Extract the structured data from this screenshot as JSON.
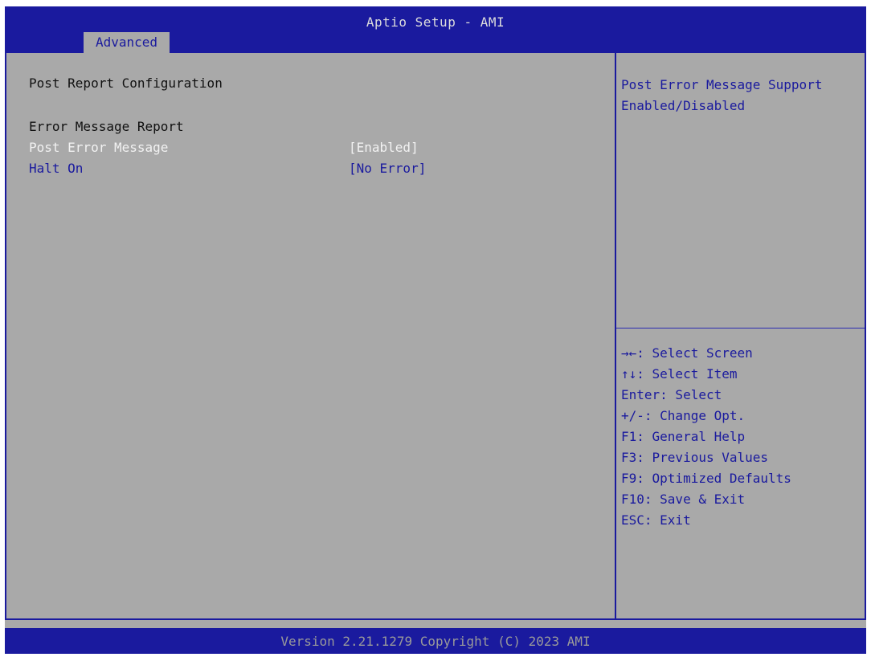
{
  "header": {
    "title": "Aptio Setup - AMI",
    "active_tab": "Advanced"
  },
  "main": {
    "section_title": "Post Report Configuration",
    "group_title": "Error Message Report",
    "settings": [
      {
        "label": "Post Error Message",
        "value": "[Enabled]"
      },
      {
        "label": "Halt On",
        "value": "[No Error]"
      }
    ]
  },
  "help": {
    "lines": [
      "Post Error Message Support",
      "Enabled/Disabled"
    ]
  },
  "keys": [
    "→←: Select Screen",
    "↑↓: Select Item",
    "Enter: Select",
    "+/-: Change Opt.",
    "F1: General Help",
    "F3: Previous Values",
    "F9: Optimized Defaults",
    "F10: Save & Exit",
    "ESC: Exit"
  ],
  "footer": {
    "text": "Version 2.21.1279 Copyright (C) 2023 AMI"
  },
  "colors": {
    "bios_blue": "#1a1a9e",
    "bios_gray": "#a9a9a9",
    "highlight_white": "#f2f2f2"
  }
}
